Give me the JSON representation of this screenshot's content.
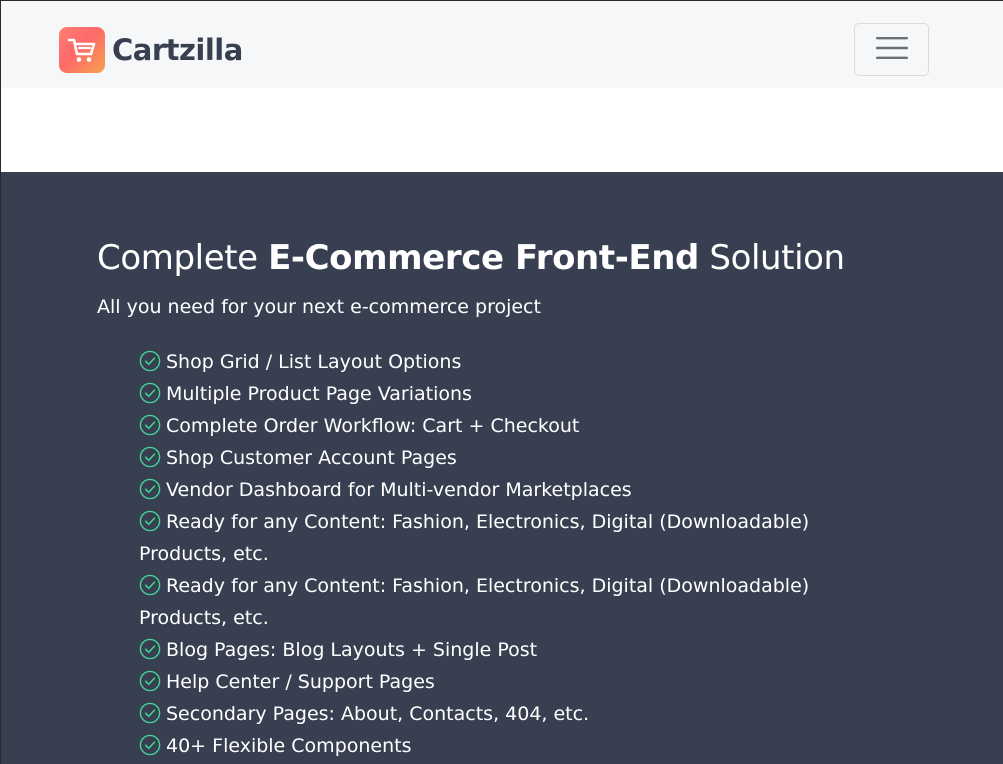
{
  "navbar": {
    "brand_name": "Cartzilla",
    "brand_icon": "cart-icon",
    "menu_icon": "hamburger-menu-icon"
  },
  "hero": {
    "title_prefix": "Complete ",
    "title_strong": "E-Commerce Front-End",
    "title_suffix": " Solution",
    "subtitle": "All you need for your next e-commerce project",
    "features": [
      "Shop Grid / List Layout Options",
      "Multiple Product Page Variations",
      "Complete Order Workflow: Cart + Checkout",
      "Shop Customer Account Pages",
      "Vendor Dashboard for Multi-vendor Marketplaces",
      "Ready for any Content: Fashion, Electronics, Digital (Downloadable) Products, etc.",
      "Ready for any Content: Fashion, Electronics, Digital (Downloadable) Products, etc.",
      "Blog Pages: Blog Layouts + Single Post",
      "Help Center / Support Pages",
      "Secondary Pages: About, Contacts, 404, etc.",
      "40+ Flexible Components"
    ]
  },
  "colors": {
    "hero_background": "#373f50",
    "navbar_background": "#f6f7f9",
    "brand_text": "#373f50",
    "check_accent": "#42d697",
    "brand_gradient_start": "#fe696a",
    "brand_gradient_end": "#f7a24d"
  }
}
